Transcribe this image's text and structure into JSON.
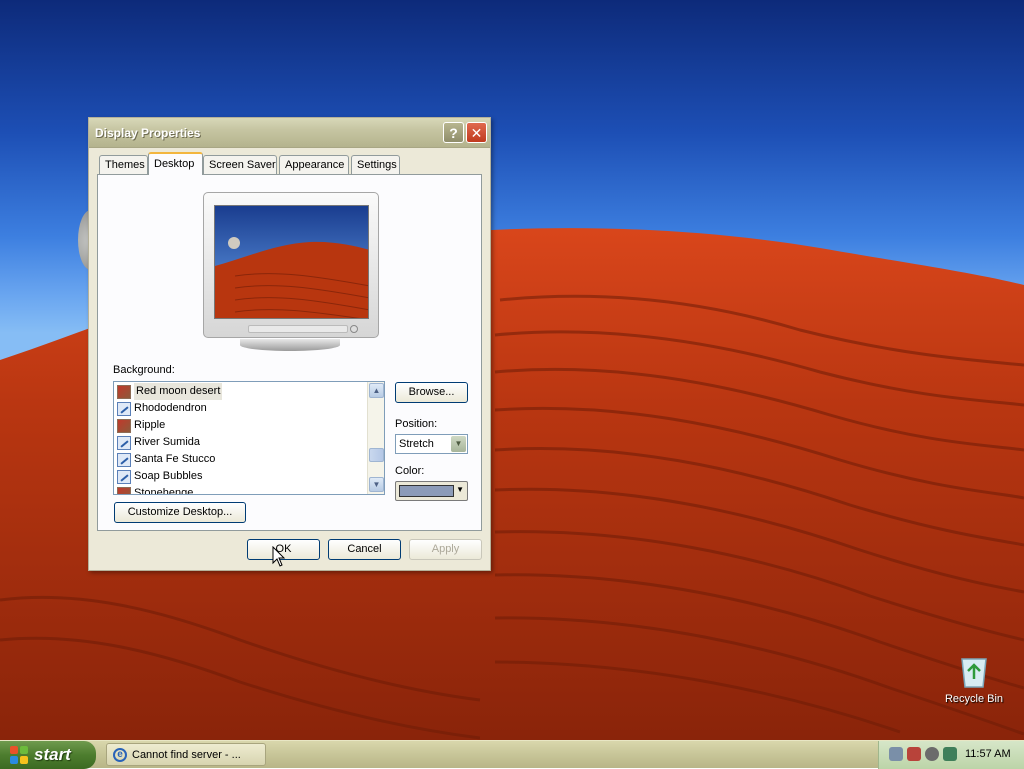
{
  "dialog": {
    "title": "Display Properties",
    "help_glyph": "?",
    "close_glyph": "✕",
    "tabs": [
      {
        "label": "Themes"
      },
      {
        "label": "Desktop"
      },
      {
        "label": "Screen Saver"
      },
      {
        "label": "Appearance"
      },
      {
        "label": "Settings"
      }
    ],
    "active_tab": "Desktop",
    "background_label": "Background:",
    "background_items": [
      {
        "label": "Red moon desert",
        "selected": true
      },
      {
        "label": "Rhododendron"
      },
      {
        "label": "Ripple"
      },
      {
        "label": "River Sumida"
      },
      {
        "label": "Santa Fe Stucco"
      },
      {
        "label": "Soap Bubbles"
      },
      {
        "label": "Stonehenge"
      }
    ],
    "browse_label": "Browse...",
    "position_label": "Position:",
    "position_value": "Stretch",
    "color_label": "Color:",
    "color_value": "#8c9bb8",
    "customize_label": "Customize Desktop...",
    "ok_label": "OK",
    "cancel_label": "Cancel",
    "apply_label": "Apply"
  },
  "desktop": {
    "icons": [
      {
        "label": "Recycle Bin",
        "icon": "recycle-bin-icon"
      }
    ]
  },
  "taskbar": {
    "start_label": "start",
    "task_items": [
      {
        "label": "Cannot find server - ...",
        "icon": "internet-explorer-icon"
      }
    ],
    "clock": "11:57 AM"
  }
}
